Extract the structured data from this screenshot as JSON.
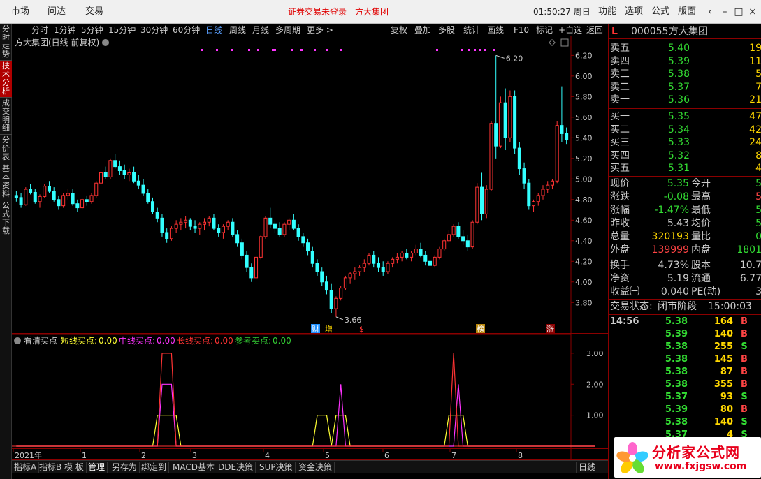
{
  "topbar": {
    "menus": [
      "市场",
      "问达",
      "交易"
    ],
    "status": "证券交易未登录　方大集团",
    "time": "01:50:27 周日",
    "right_menus": [
      "功能",
      "选项",
      "公式",
      "版面"
    ]
  },
  "vtabs": [
    "分时走势",
    "技术分析",
    "成交明细",
    "分价表",
    "基本资料",
    "公式下载"
  ],
  "toolbar": {
    "periods": [
      "分时",
      "1分钟",
      "5分钟",
      "15分钟",
      "30分钟",
      "60分钟",
      "日线",
      "周线",
      "月线",
      "多周期",
      "更多 >"
    ],
    "tools": [
      "复权",
      "叠加",
      "多股",
      "统计",
      "画线",
      "F10",
      "标记",
      "+自选",
      "返回"
    ]
  },
  "main_chart": {
    "title": "方大集团(日线 前复权)",
    "y_ticks": [
      "6.20",
      "6.00",
      "5.80",
      "5.60",
      "5.40",
      "5.20",
      "5.00",
      "4.80",
      "4.60",
      "4.40",
      "4.20",
      "4.00",
      "3.80"
    ],
    "high_label": "6.20",
    "low_label": "3.66",
    "markers": [
      "财",
      "增",
      "$",
      "榜",
      "涨"
    ]
  },
  "sub_chart": {
    "title": "看清买点",
    "legend": [
      {
        "label": "短线买点:",
        "value": "0.00",
        "color": "#ffff33"
      },
      {
        "label": "中线买点:",
        "value": "0.00",
        "color": "#ff33ff"
      },
      {
        "label": "长线买点:",
        "value": "0.00",
        "color": "#ff3333"
      },
      {
        "label": "参考卖点:",
        "value": "0.00",
        "color": "#33cc33"
      }
    ],
    "y_ticks": [
      "3.00",
      "2.00",
      "1.00"
    ]
  },
  "chart_data": {
    "type": "candlestick",
    "title": "方大集团(日线 前复权)",
    "x_labels": [
      "2021年",
      "1",
      "2",
      "3",
      "4",
      "5",
      "6",
      "7",
      "8"
    ],
    "ylim": [
      3.7,
      6.25
    ],
    "high": 6.2,
    "low": 3.66,
    "candles": [
      [
        4.84,
        4.88,
        4.78,
        4.82
      ],
      [
        4.82,
        4.86,
        4.72,
        4.75
      ],
      [
        4.75,
        4.92,
        4.74,
        4.9
      ],
      [
        4.9,
        4.95,
        4.85,
        4.87
      ],
      [
        4.87,
        4.9,
        4.76,
        4.78
      ],
      [
        4.78,
        4.85,
        4.72,
        4.83
      ],
      [
        4.83,
        4.95,
        4.82,
        4.93
      ],
      [
        4.93,
        4.98,
        4.86,
        4.88
      ],
      [
        4.88,
        4.92,
        4.78,
        4.8
      ],
      [
        4.8,
        4.84,
        4.7,
        4.74
      ],
      [
        4.74,
        4.86,
        4.72,
        4.84
      ],
      [
        4.84,
        4.9,
        4.8,
        4.86
      ],
      [
        4.86,
        4.9,
        4.74,
        4.76
      ],
      [
        4.76,
        4.8,
        4.68,
        4.72
      ],
      [
        4.72,
        4.82,
        4.7,
        4.8
      ],
      [
        4.8,
        4.84,
        4.74,
        4.78
      ],
      [
        4.78,
        4.86,
        4.76,
        4.84
      ],
      [
        4.84,
        4.98,
        4.82,
        4.96
      ],
      [
        4.96,
        5.08,
        4.94,
        5.06
      ],
      [
        5.06,
        5.12,
        5.0,
        5.02
      ],
      [
        5.02,
        5.2,
        5.0,
        5.18
      ],
      [
        5.18,
        5.24,
        5.1,
        5.12
      ],
      [
        5.12,
        5.18,
        5.04,
        5.08
      ],
      [
        5.08,
        5.14,
        5.0,
        5.04
      ],
      [
        5.04,
        5.1,
        4.98,
        5.06
      ],
      [
        5.06,
        5.12,
        4.96,
        4.98
      ],
      [
        4.98,
        5.04,
        4.9,
        4.94
      ],
      [
        4.94,
        5.0,
        4.84,
        4.86
      ],
      [
        4.86,
        4.9,
        4.76,
        4.78
      ],
      [
        4.78,
        4.82,
        4.66,
        4.68
      ],
      [
        4.68,
        4.72,
        4.58,
        4.62
      ],
      [
        4.62,
        4.66,
        4.44,
        4.48
      ],
      [
        4.48,
        4.52,
        4.38,
        4.42
      ],
      [
        4.42,
        4.54,
        4.4,
        4.52
      ],
      [
        4.52,
        4.6,
        4.48,
        4.56
      ],
      [
        4.56,
        4.62,
        4.5,
        4.58
      ],
      [
        4.58,
        4.64,
        4.52,
        4.6
      ],
      [
        4.6,
        4.62,
        4.5,
        4.54
      ],
      [
        4.54,
        4.6,
        4.48,
        4.52
      ],
      [
        4.52,
        4.58,
        4.46,
        4.56
      ],
      [
        4.56,
        4.62,
        4.5,
        4.58
      ],
      [
        4.58,
        4.64,
        4.54,
        4.62
      ],
      [
        4.62,
        4.66,
        4.5,
        4.52
      ],
      [
        4.52,
        4.56,
        4.44,
        4.48
      ],
      [
        4.48,
        4.56,
        4.42,
        4.54
      ],
      [
        4.54,
        4.6,
        4.5,
        4.58
      ],
      [
        4.58,
        4.62,
        4.44,
        4.46
      ],
      [
        4.46,
        4.5,
        4.34,
        4.38
      ],
      [
        4.38,
        4.42,
        4.22,
        4.26
      ],
      [
        4.26,
        4.3,
        4.1,
        4.14
      ],
      [
        4.14,
        4.18,
        4.0,
        4.04
      ],
      [
        4.04,
        4.26,
        4.02,
        4.24
      ],
      [
        4.24,
        4.46,
        4.22,
        4.44
      ],
      [
        4.44,
        4.64,
        4.42,
        4.62
      ],
      [
        4.62,
        4.72,
        4.52,
        4.56
      ],
      [
        4.56,
        4.6,
        4.48,
        4.52
      ],
      [
        4.52,
        4.58,
        4.44,
        4.46
      ],
      [
        4.46,
        4.58,
        4.44,
        4.56
      ],
      [
        4.56,
        4.62,
        4.5,
        4.6
      ],
      [
        4.6,
        4.66,
        4.5,
        4.52
      ],
      [
        4.52,
        4.56,
        4.4,
        4.44
      ],
      [
        4.44,
        4.48,
        4.34,
        4.38
      ],
      [
        4.38,
        4.42,
        4.26,
        4.3
      ],
      [
        4.3,
        4.34,
        4.14,
        4.18
      ],
      [
        4.18,
        4.22,
        4.06,
        4.1
      ],
      [
        4.1,
        4.14,
        3.96,
        4.0
      ],
      [
        4.0,
        4.06,
        3.88,
        3.92
      ],
      [
        3.92,
        3.98,
        3.7,
        3.74
      ],
      [
        3.74,
        3.86,
        3.66,
        3.84
      ],
      [
        3.84,
        3.96,
        3.82,
        3.94
      ],
      [
        3.94,
        4.06,
        3.92,
        4.04
      ],
      [
        4.04,
        4.1,
        3.98,
        4.08
      ],
      [
        4.08,
        4.14,
        4.02,
        4.1
      ],
      [
        4.1,
        4.16,
        4.06,
        4.14
      ],
      [
        4.14,
        4.22,
        4.1,
        4.18
      ],
      [
        4.18,
        4.28,
        4.16,
        4.26
      ],
      [
        4.26,
        4.3,
        4.14,
        4.18
      ],
      [
        4.18,
        4.24,
        4.1,
        4.14
      ],
      [
        4.14,
        4.2,
        4.06,
        4.1
      ],
      [
        4.1,
        4.2,
        4.08,
        4.18
      ],
      [
        4.18,
        4.24,
        4.14,
        4.22
      ],
      [
        4.22,
        4.28,
        4.18,
        4.24
      ],
      [
        4.24,
        4.3,
        4.2,
        4.28
      ],
      [
        4.28,
        4.32,
        4.22,
        4.24
      ],
      [
        4.24,
        4.3,
        4.2,
        4.28
      ],
      [
        4.28,
        4.36,
        4.26,
        4.32
      ],
      [
        4.32,
        4.38,
        4.24,
        4.26
      ],
      [
        4.26,
        4.3,
        4.16,
        4.2
      ],
      [
        4.2,
        4.26,
        4.14,
        4.16
      ],
      [
        4.16,
        4.26,
        4.14,
        4.24
      ],
      [
        4.24,
        4.34,
        4.22,
        4.32
      ],
      [
        4.32,
        4.42,
        4.3,
        4.4
      ],
      [
        4.4,
        4.5,
        4.38,
        4.46
      ],
      [
        4.46,
        4.56,
        4.44,
        4.54
      ],
      [
        4.54,
        4.58,
        4.42,
        4.44
      ],
      [
        4.44,
        4.5,
        4.36,
        4.4
      ],
      [
        4.4,
        4.46,
        4.3,
        4.34
      ],
      [
        4.34,
        4.6,
        4.32,
        4.58
      ],
      [
        4.58,
        4.96,
        4.56,
        4.92
      ],
      [
        4.92,
        5.06,
        4.6,
        4.66
      ],
      [
        4.66,
        4.94,
        4.62,
        4.9
      ],
      [
        4.9,
        5.56,
        4.88,
        5.54
      ],
      [
        5.54,
        6.2,
        5.2,
        5.32
      ],
      [
        5.32,
        5.8,
        5.3,
        5.74
      ],
      [
        5.74,
        5.88,
        5.28,
        5.4
      ],
      [
        5.4,
        5.86,
        5.36,
        5.8
      ],
      [
        5.8,
        5.86,
        5.24,
        5.3
      ],
      [
        5.3,
        5.36,
        5.04,
        5.1
      ],
      [
        5.1,
        5.16,
        4.9,
        4.96
      ],
      [
        4.96,
        5.0,
        4.7,
        4.74
      ],
      [
        4.74,
        4.8,
        4.68,
        4.78
      ],
      [
        4.78,
        4.86,
        4.74,
        4.84
      ],
      [
        4.84,
        4.94,
        4.8,
        4.9
      ],
      [
        4.9,
        4.98,
        4.86,
        4.94
      ],
      [
        4.94,
        5.0,
        4.9,
        4.98
      ],
      [
        4.98,
        5.56,
        4.96,
        5.52
      ],
      [
        5.52,
        5.9,
        5.36,
        5.44
      ],
      [
        5.44,
        5.5,
        5.34,
        5.38
      ]
    ],
    "series": [
      {
        "name": "短线买点",
        "color": "#ffff33",
        "values": [
          0,
          0,
          0,
          0,
          0,
          0,
          0,
          0,
          0,
          0,
          0,
          0,
          0,
          0,
          0,
          0,
          0,
          0,
          0,
          0,
          0,
          0,
          0,
          0,
          0,
          0,
          0,
          0,
          0,
          0,
          1,
          1,
          1,
          1,
          1,
          0,
          0,
          0,
          0,
          0,
          0,
          0,
          0,
          0,
          0,
          0,
          0,
          0,
          0,
          0,
          0,
          0,
          0,
          0,
          0,
          0,
          0,
          0,
          0,
          0,
          0,
          0,
          0,
          0,
          1,
          1,
          1,
          0,
          1,
          1,
          1,
          0,
          0,
          0,
          0,
          0,
          0,
          0,
          0,
          0,
          0,
          0,
          0,
          0,
          0,
          0,
          0,
          0,
          0,
          0,
          0,
          0,
          1,
          1,
          1,
          1,
          0,
          0,
          0,
          0,
          0,
          0,
          0,
          0,
          0,
          0,
          0,
          0,
          0,
          0,
          0,
          0,
          0,
          0,
          0,
          0,
          0,
          0,
          0,
          0,
          0,
          0,
          0,
          0
        ]
      },
      {
        "name": "中线买点",
        "color": "#ff33ff",
        "values": [
          0,
          0,
          0,
          0,
          0,
          0,
          0,
          0,
          0,
          0,
          0,
          0,
          0,
          0,
          0,
          0,
          0,
          0,
          0,
          0,
          0,
          0,
          0,
          0,
          0,
          0,
          0,
          0,
          0,
          0,
          0,
          2,
          2,
          2,
          0,
          0,
          0,
          0,
          0,
          0,
          0,
          0,
          0,
          0,
          0,
          0,
          0,
          0,
          0,
          0,
          0,
          0,
          0,
          0,
          0,
          0,
          0,
          0,
          0,
          0,
          0,
          0,
          0,
          0,
          0,
          0,
          0,
          0,
          0,
          2,
          0,
          0,
          0,
          0,
          0,
          0,
          0,
          0,
          0,
          0,
          0,
          0,
          0,
          0,
          0,
          0,
          0,
          0,
          0,
          0,
          0,
          0,
          0,
          0,
          2,
          0,
          0,
          0,
          0,
          0,
          0,
          0,
          0,
          0,
          0,
          0,
          0,
          0,
          0,
          0,
          0,
          0,
          0,
          0,
          0,
          0,
          0,
          0,
          0,
          0,
          0,
          0,
          0,
          0
        ]
      },
      {
        "name": "长线买点",
        "color": "#ff3333",
        "values": [
          0,
          0,
          0,
          0,
          0,
          0,
          0,
          0,
          0,
          0,
          0,
          0,
          0,
          0,
          0,
          0,
          0,
          0,
          0,
          0,
          0,
          0,
          0,
          0,
          0,
          0,
          0,
          0,
          0,
          0,
          0,
          3,
          3,
          3,
          0,
          0,
          0,
          0,
          0,
          0,
          0,
          0,
          0,
          0,
          0,
          0,
          0,
          0,
          0,
          0,
          0,
          0,
          0,
          0,
          0,
          0,
          0,
          0,
          0,
          0,
          0,
          0,
          0,
          0,
          0,
          0,
          0,
          0,
          0,
          0,
          0,
          0,
          0,
          0,
          0,
          0,
          0,
          0,
          0,
          0,
          0,
          0,
          0,
          0,
          0,
          0,
          0,
          0,
          0,
          0,
          0,
          0,
          0,
          3,
          0,
          0,
          0,
          0,
          0,
          0,
          0,
          0,
          0,
          0,
          0,
          0,
          0,
          0,
          0,
          0,
          0,
          0,
          0,
          0,
          0,
          0,
          0,
          0,
          0,
          0,
          0,
          0,
          0,
          0
        ]
      }
    ]
  },
  "bottombar": {
    "tabs": [
      "指标A",
      "指标B",
      "模 板",
      "管理",
      "另存为",
      "绑定到",
      "MACD基本",
      "DDE决策",
      "SUP决策",
      "资金决策"
    ],
    "period": "日线"
  },
  "rpanel": {
    "code": "000055",
    "name": "方大集团",
    "flag": "L",
    "asks": [
      {
        "label": "卖五",
        "price": "5.40",
        "vol": "19"
      },
      {
        "label": "卖四",
        "price": "5.39",
        "vol": "11"
      },
      {
        "label": "卖三",
        "price": "5.38",
        "vol": "5"
      },
      {
        "label": "卖二",
        "price": "5.37",
        "vol": "7"
      },
      {
        "label": "卖一",
        "price": "5.36",
        "vol": "21"
      }
    ],
    "bids": [
      {
        "label": "买一",
        "price": "5.35",
        "vol": "47"
      },
      {
        "label": "买二",
        "price": "5.34",
        "vol": "42"
      },
      {
        "label": "买三",
        "price": "5.33",
        "vol": "24"
      },
      {
        "label": "买四",
        "price": "5.32",
        "vol": "8"
      },
      {
        "label": "买五",
        "price": "5.31",
        "vol": "4"
      }
    ],
    "quotes": [
      {
        "l1": "现价",
        "v1": "5.35",
        "c1": "#33dd33",
        "l2": "今开",
        "v2": "5",
        "c2": "#33dd33"
      },
      {
        "l1": "涨跌",
        "v1": "-0.08",
        "c1": "#33dd33",
        "l2": "最高",
        "v2": "5",
        "c2": "#ff4444"
      },
      {
        "l1": "涨幅",
        "v1": "-1.47%",
        "c1": "#33dd33",
        "l2": "最低",
        "v2": "5",
        "c2": "#33dd33"
      },
      {
        "l1": "昨收",
        "v1": "5.43",
        "c1": "#cccccc",
        "l2": "均价",
        "v2": "5",
        "c2": "#33dd33"
      },
      {
        "l1": "总量",
        "v1": "320193",
        "c1": "#ffd700",
        "l2": "量比",
        "v2": "0",
        "c2": "#33dd33"
      },
      {
        "l1": "外盘",
        "v1": "139999",
        "c1": "#ff4444",
        "l2": "内盘",
        "v2": "1801",
        "c2": "#33dd33"
      }
    ],
    "quotes2": [
      {
        "l1": "换手",
        "v1": "4.73%",
        "c1": "#cccccc",
        "l2": "股本",
        "v2": "10.7",
        "c2": "#cccccc"
      },
      {
        "l1": "净资",
        "v1": "5.19",
        "c1": "#cccccc",
        "l2": "流通",
        "v2": "6.77",
        "c2": "#cccccc"
      },
      {
        "l1": "收益㈠",
        "v1": "0.040",
        "c1": "#cccccc",
        "l2": "PE(动)",
        "v2": "3",
        "c2": "#cccccc"
      }
    ],
    "trade_state_label": "交易状态:",
    "trade_state": "闭市阶段",
    "trade_time": "15:00:03",
    "ticks": [
      {
        "time": "14:56",
        "price": "5.38",
        "vol": "164",
        "bs": "B"
      },
      {
        "time": "",
        "price": "5.39",
        "vol": "140",
        "bs": "B"
      },
      {
        "time": "",
        "price": "5.38",
        "vol": "255",
        "bs": "S"
      },
      {
        "time": "",
        "price": "5.38",
        "vol": "145",
        "bs": "B"
      },
      {
        "time": "",
        "price": "5.38",
        "vol": "87",
        "bs": "B"
      },
      {
        "time": "",
        "price": "5.38",
        "vol": "355",
        "bs": "B"
      },
      {
        "time": "",
        "price": "5.37",
        "vol": "93",
        "bs": "S"
      },
      {
        "time": "",
        "price": "5.39",
        "vol": "80",
        "bs": "B"
      },
      {
        "time": "",
        "price": "5.38",
        "vol": "140",
        "bs": "S"
      },
      {
        "time": "",
        "price": "5.37",
        "vol": "4",
        "bs": "S"
      }
    ]
  },
  "logo": {
    "name": "分析家公式网",
    "url": "www.fxjgsw.com"
  }
}
